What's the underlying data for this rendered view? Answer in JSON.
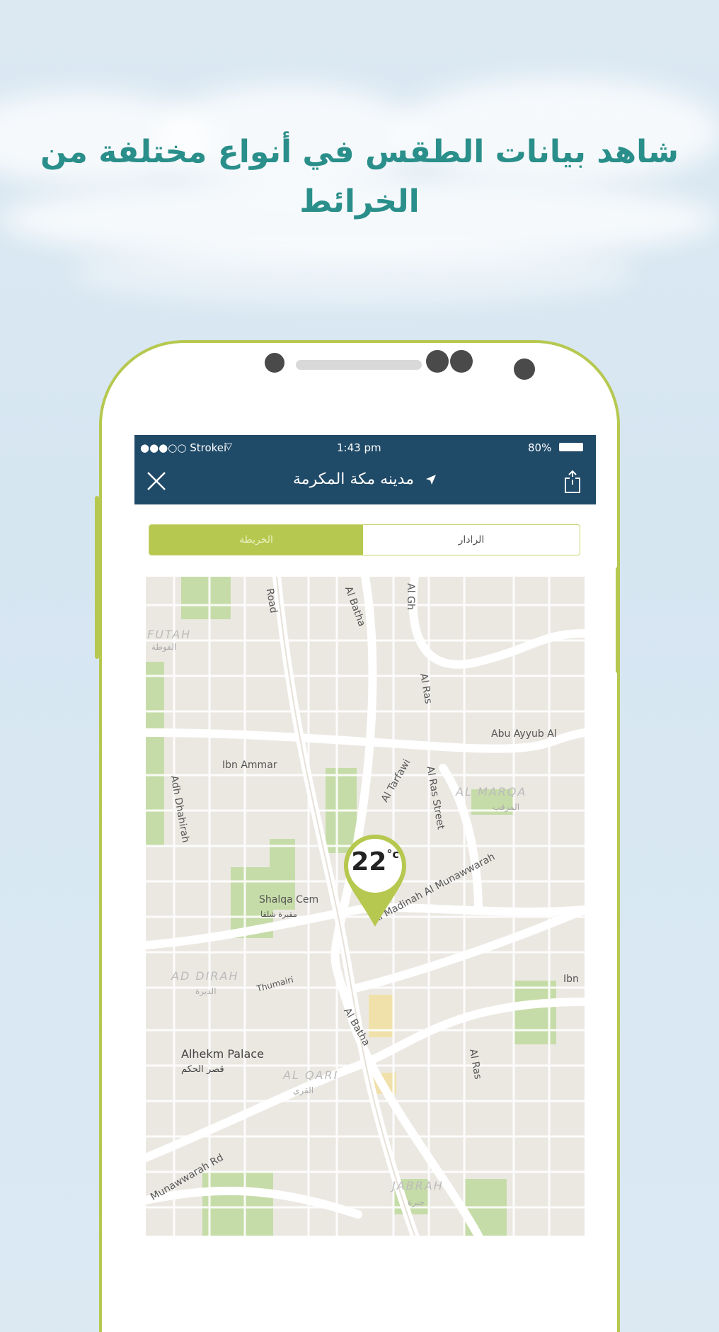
{
  "headline": {
    "line1": "شاهد بيانات الطقس في أنواع مختلفة من",
    "line2": "الخرائط"
  },
  "status_bar": {
    "carrier": "●●●○○ Strokei",
    "time": "1:43 pm",
    "battery": "80%"
  },
  "nav": {
    "title": "مدينه مكة المكرمة",
    "close_icon": "close-icon",
    "share_icon": "share-icon",
    "location_icon": "location-arrow-icon"
  },
  "segments": {
    "radar": "الرادار",
    "map": "الخريطة",
    "selected": "map"
  },
  "map": {
    "temperature": "22",
    "unit": "°c",
    "labels": {
      "futah": "FUTAH",
      "futah_ar": "الفوطة",
      "road": "Road",
      "al_batha_top": "Al Batha",
      "algh": "Al Gh",
      "al_ras": "Al Ras",
      "abu_ayyub": "Abu Ayyub Al",
      "ibn_ammar": "Ibn Ammar",
      "adh_dhahirah": "Adh Dhahirah",
      "al_tarfawi": "Al Tarfawi",
      "al_ras_street": "Al Ras Street",
      "al_marqab": "AL MARQA",
      "al_marqab_ar": "المرقب",
      "shalqa": "Shalqa Cem",
      "shalqa_ar": "مقبرة شلقا",
      "ad_dirah": "AD DIRAH",
      "ad_dirah_ar": "الديرة",
      "thumairi": "Thumairi",
      "al_madinah": "Al Madinah Al Munawwarah",
      "al_batha_bottom": "Al Batha",
      "alhekm": "Alhekm Palace",
      "alhekm_ar": "قصر الحكم",
      "al_qari": "AL QARI",
      "al_qari_ar": "القري",
      "al_ras_bottom": "Al Ras",
      "munawwarah_rd": "Munawwarah Rd",
      "jabrah": "JABRAH",
      "jabrah_ar": "جبرة",
      "ibn": "Ibn"
    }
  },
  "colors": {
    "accent": "#b6c84f",
    "nav": "#1f4a68",
    "headline": "#2a8f8a"
  }
}
